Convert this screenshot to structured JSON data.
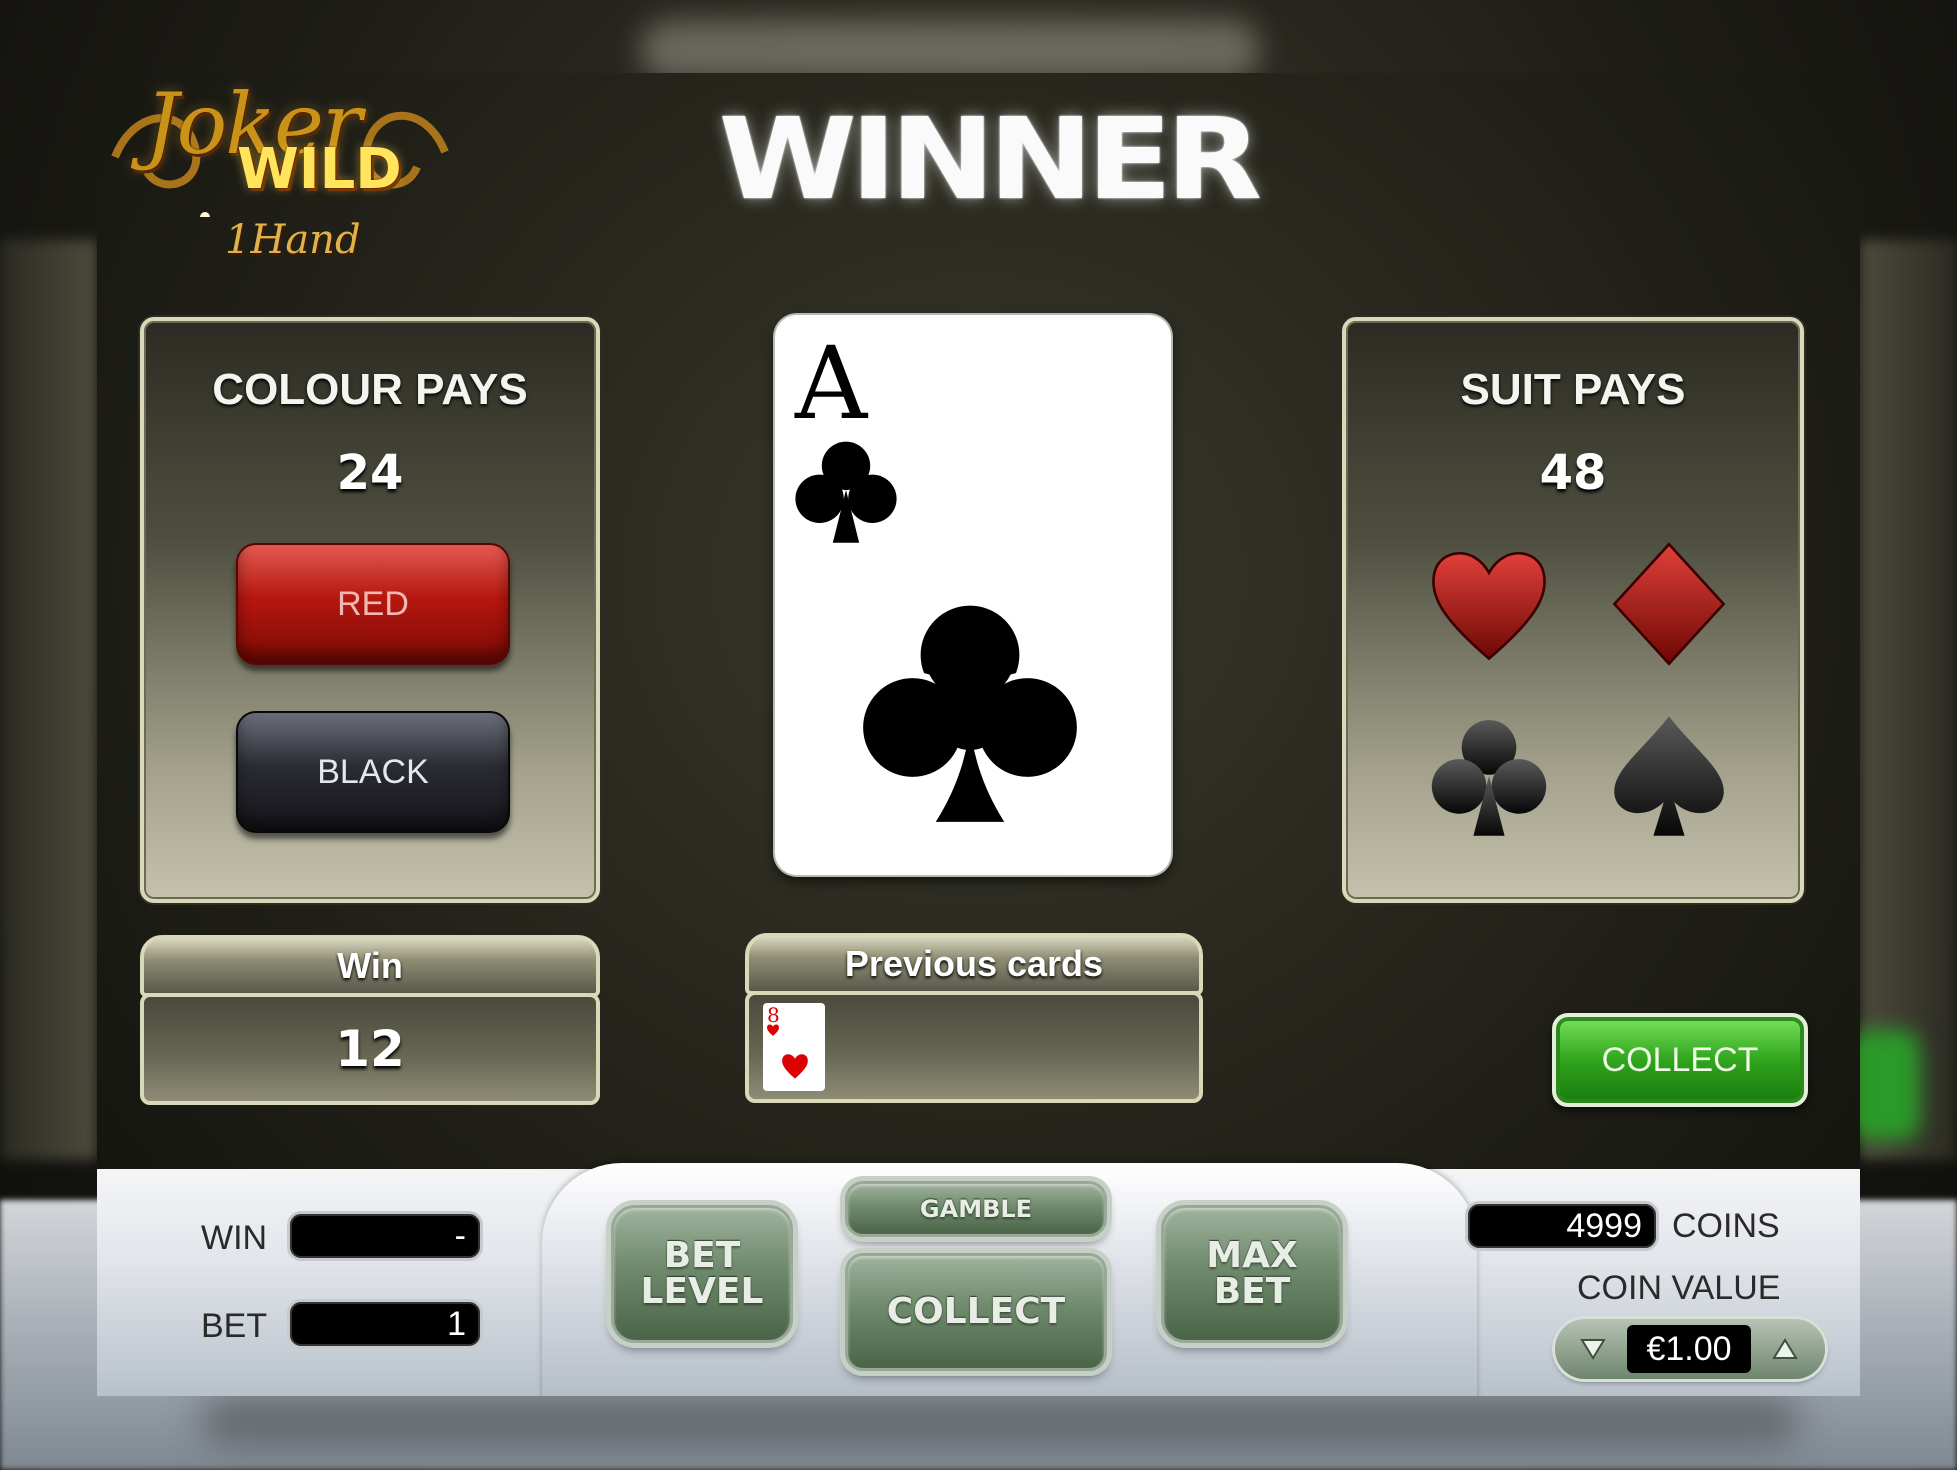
{
  "logo": {
    "line1": "Joker",
    "line2": "WILD",
    "line3": "1Hand"
  },
  "banner": {
    "text": "WINNER"
  },
  "colour_panel": {
    "title": "COLOUR PAYS",
    "value": "24",
    "red_label": "RED",
    "black_label": "BLACK"
  },
  "suit_panel": {
    "title": "SUIT PAYS",
    "value": "48",
    "suits": [
      "heart-icon",
      "diamond-icon",
      "club-icon",
      "spade-icon"
    ]
  },
  "card": {
    "rank": "A",
    "suit": "clubs",
    "color": "#000000"
  },
  "win_box": {
    "label": "Win",
    "value": "12"
  },
  "previous_cards": {
    "label": "Previous cards",
    "cards": [
      {
        "rank": "8",
        "suit": "hearts",
        "color": "#dd0000"
      }
    ]
  },
  "collect_button": {
    "label": "COLLECT"
  },
  "controls": {
    "win_label": "WIN",
    "win_value": "-",
    "bet_label": "BET",
    "bet_value": "1",
    "bet_level_line1": "BET",
    "bet_level_line2": "LEVEL",
    "gamble_label": "GAMBLE",
    "collect_label": "COLLECT",
    "max_bet_line1": "MAX",
    "max_bet_line2": "BET",
    "coins_value": "4999",
    "coins_label": "COINS",
    "coin_value_label": "COIN VALUE",
    "coin_value": "€1.00"
  },
  "colors": {
    "red": "#b5170f",
    "green": "#2fa51d",
    "panel_border": "#d9d8b8"
  }
}
